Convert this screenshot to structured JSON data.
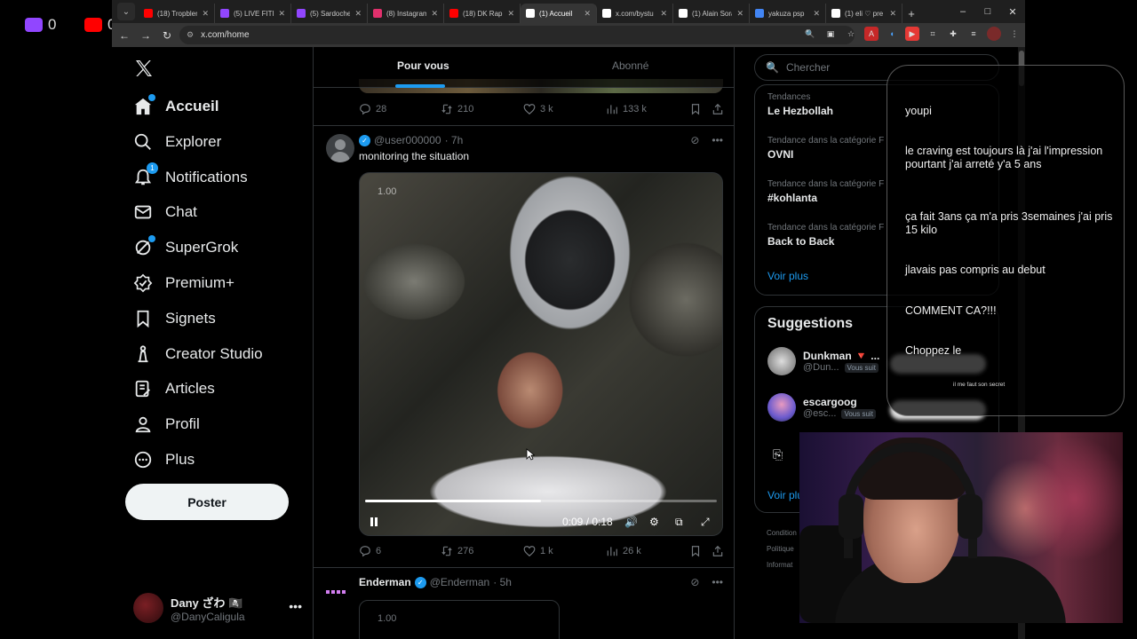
{
  "stream": {
    "counters": [
      {
        "platform": "twitch-icon",
        "value": "0",
        "color": "#9146ff"
      },
      {
        "platform": "youtube-icon",
        "value": "0",
        "color": "#ff0000"
      }
    ]
  },
  "browser": {
    "tabs": [
      {
        "title": "(18) Tropblem",
        "favicon": "youtube",
        "color": "#ff0000"
      },
      {
        "title": "(5) LIVE FITE",
        "favicon": "twitch",
        "color": "#9146ff"
      },
      {
        "title": "(5) Sardoche",
        "favicon": "twitch",
        "color": "#9146ff"
      },
      {
        "title": "(8) Instagram",
        "favicon": "instagram",
        "color": "#e1306c"
      },
      {
        "title": "(18) DK Rap",
        "favicon": "youtube",
        "color": "#ff0000"
      },
      {
        "title": "(1) Accueil",
        "favicon": "x",
        "color": "#ffffff",
        "active": true
      },
      {
        "title": "x.com/bystu",
        "favicon": "x",
        "color": "#ffffff"
      },
      {
        "title": "(1) Alain Soral",
        "favicon": "x",
        "color": "#ffffff"
      },
      {
        "title": "yakuza psp",
        "favicon": "google",
        "color": "#4285f4"
      },
      {
        "title": "(1) eli ♡ pre",
        "favicon": "x",
        "color": "#ffffff"
      }
    ],
    "url": "x.com/home"
  },
  "nav": {
    "items": [
      {
        "label": "Accueil",
        "icon": "home-icon"
      },
      {
        "label": "Explorer",
        "icon": "search-icon"
      },
      {
        "label": "Notifications",
        "icon": "bell-icon",
        "badge": "1"
      },
      {
        "label": "Chat",
        "icon": "mail-icon"
      },
      {
        "label": "SuperGrok",
        "icon": "grok-icon"
      },
      {
        "label": "Premium+",
        "icon": "premium-icon"
      },
      {
        "label": "Signets",
        "icon": "bookmark-icon"
      },
      {
        "label": "Creator Studio",
        "icon": "creator-icon"
      },
      {
        "label": "Articles",
        "icon": "articles-icon"
      },
      {
        "label": "Profil",
        "icon": "profile-icon"
      },
      {
        "label": "Plus",
        "icon": "more-icon"
      }
    ],
    "post_button": "Poster",
    "account": {
      "name": "Dany ざわ 🏴‍☠️",
      "handle": "@DanyCaligula"
    }
  },
  "timeline": {
    "tabs": [
      "Pour vous",
      "Abonné"
    ],
    "post1_stats": {
      "replies": "28",
      "reposts": "210",
      "likes": "3 k",
      "views": "133 k"
    },
    "post2": {
      "handle": "@user000000",
      "time": "· 7h",
      "text": "monitoring the situation",
      "video": {
        "rate": "1.00",
        "time": "0:09 / 0:18",
        "progress": 0.5
      },
      "stats": {
        "replies": "6",
        "reposts": "276",
        "likes": "1 k",
        "views": "26 k"
      }
    },
    "post3": {
      "name": "Enderman",
      "handle": "@Enderman",
      "time": "· 5h",
      "rate": "1.00"
    }
  },
  "right": {
    "search_placeholder": "Chercher",
    "trends": [
      {
        "category": "Tendances",
        "title": "Le Hezbollah"
      },
      {
        "category": "Tendance dans la catégorie F",
        "title": "OVNI"
      },
      {
        "category": "Tendance dans la catégorie F",
        "title": "#kohlanta"
      },
      {
        "category": "Tendance dans la catégorie F",
        "title": "Back to Back"
      }
    ],
    "show_more": "Voir plus",
    "suggestions_title": "Suggestions",
    "suggestions": [
      {
        "name": "Dunkman 🔻 ...",
        "handle": "@Dun...",
        "follows": "Vous suit"
      },
      {
        "name": "escargoog",
        "handle": "@esc...",
        "follows": "Vous suit"
      }
    ],
    "show_more2": "Voir plu",
    "footer": [
      "Condition",
      "Politique",
      "Informat"
    ]
  },
  "chat": {
    "messages": [
      "youpi",
      "le craving est toujours là j'ai l'impression pourtant j'ai arreté y'a 5 ans",
      "ça fait 3ans ça m'a pris 3semaines j'ai pris 15 kilo",
      "jlavais pas compris au debut",
      "COMMENT CA?!!!",
      "Choppez le"
    ],
    "small_text": "il me faut son secret"
  }
}
